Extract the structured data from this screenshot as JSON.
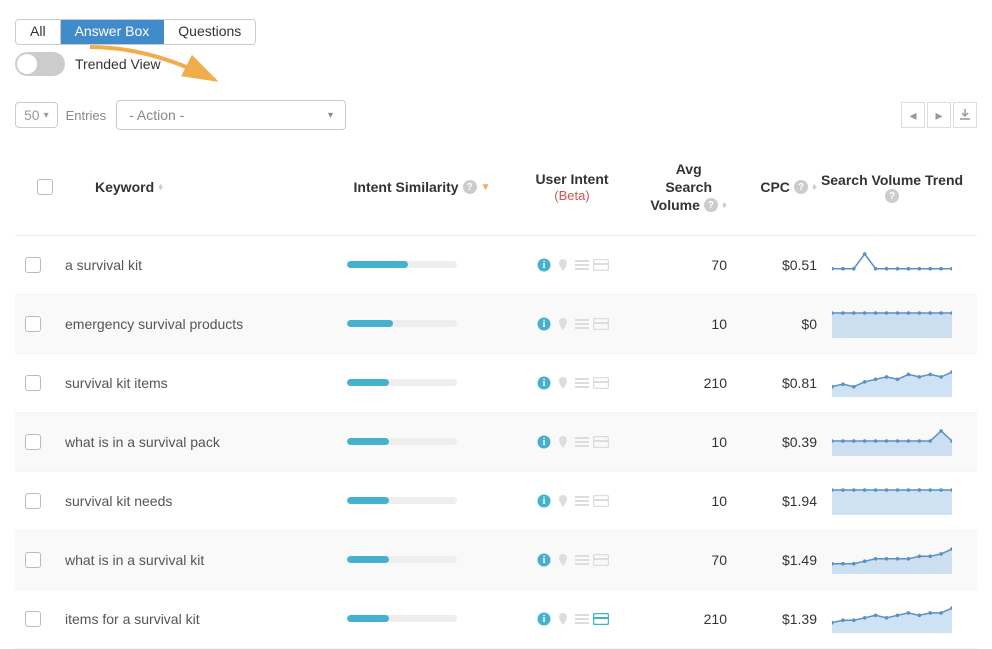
{
  "tabs": {
    "all": "All",
    "answerbox": "Answer Box",
    "questions": "Questions",
    "active": "answerbox"
  },
  "toggle": {
    "label": "Trended View"
  },
  "controls": {
    "entries_value": "50",
    "entries_label": "Entries",
    "action_placeholder": "- Action -"
  },
  "headers": {
    "keyword": "Keyword",
    "intent_similarity": "Intent Similarity",
    "user_intent": "User Intent",
    "user_intent_beta": "(Beta)",
    "avg_search_volume": "Avg Search Volume",
    "avg_l1": "Avg",
    "avg_l2": "Search",
    "avg_l3": "Volume",
    "cpc": "CPC",
    "search_volume_trend": "Search Volume Trend"
  },
  "rows": [
    {
      "keyword": "a survival kit",
      "intent": 55,
      "avg": "70",
      "cpc": "$0.51",
      "spark": [
        4,
        4,
        4,
        12,
        4,
        4,
        4,
        4,
        4,
        4,
        4,
        4
      ],
      "area": false,
      "card": false
    },
    {
      "keyword": "emergency survival products",
      "intent": 42,
      "avg": "10",
      "cpc": "$0",
      "spark": [
        8,
        8,
        8,
        8,
        8,
        8,
        8,
        8,
        8,
        8,
        8,
        8
      ],
      "area": true,
      "card": false
    },
    {
      "keyword": "survival kit items",
      "intent": 38,
      "avg": "210",
      "cpc": "$0.81",
      "spark": [
        3,
        4,
        3,
        5,
        6,
        7,
        6,
        8,
        7,
        8,
        7,
        9
      ],
      "area": true,
      "card": false
    },
    {
      "keyword": "what is in a survival pack",
      "intent": 38,
      "avg": "10",
      "cpc": "$0.39",
      "spark": [
        6,
        6,
        6,
        6,
        6,
        6,
        6,
        6,
        6,
        6,
        11,
        6
      ],
      "area": true,
      "card": false
    },
    {
      "keyword": "survival kit needs",
      "intent": 38,
      "avg": "10",
      "cpc": "$1.94",
      "spark": [
        8,
        8,
        8,
        8,
        8,
        8,
        8,
        8,
        8,
        8,
        8,
        8
      ],
      "area": true,
      "card": false
    },
    {
      "keyword": "what is in a survival kit",
      "intent": 38,
      "avg": "70",
      "cpc": "$1.49",
      "spark": [
        3,
        3,
        3,
        4,
        5,
        5,
        5,
        5,
        6,
        6,
        7,
        9
      ],
      "area": true,
      "card": false
    },
    {
      "keyword": "items for a survival kit",
      "intent": 38,
      "avg": "210",
      "cpc": "$1.39",
      "spark": [
        3,
        4,
        4,
        5,
        6,
        5,
        6,
        7,
        6,
        7,
        7,
        9
      ],
      "area": true,
      "card": true
    }
  ],
  "chart_data": [
    {
      "type": "line",
      "title": "Search Volume Trend — a survival kit",
      "values": [
        4,
        4,
        4,
        12,
        4,
        4,
        4,
        4,
        4,
        4,
        4,
        4
      ]
    },
    {
      "type": "area",
      "title": "Search Volume Trend — emergency survival products",
      "values": [
        8,
        8,
        8,
        8,
        8,
        8,
        8,
        8,
        8,
        8,
        8,
        8
      ]
    },
    {
      "type": "area",
      "title": "Search Volume Trend — survival kit items",
      "values": [
        3,
        4,
        3,
        5,
        6,
        7,
        6,
        8,
        7,
        8,
        7,
        9
      ]
    },
    {
      "type": "area",
      "title": "Search Volume Trend — what is in a survival pack",
      "values": [
        6,
        6,
        6,
        6,
        6,
        6,
        6,
        6,
        6,
        6,
        11,
        6
      ]
    },
    {
      "type": "area",
      "title": "Search Volume Trend — survival kit needs",
      "values": [
        8,
        8,
        8,
        8,
        8,
        8,
        8,
        8,
        8,
        8,
        8,
        8
      ]
    },
    {
      "type": "area",
      "title": "Search Volume Trend — what is in a survival kit",
      "values": [
        3,
        3,
        3,
        4,
        5,
        5,
        5,
        5,
        6,
        6,
        7,
        9
      ]
    },
    {
      "type": "area",
      "title": "Search Volume Trend — items for a survival kit",
      "values": [
        3,
        4,
        4,
        5,
        6,
        5,
        6,
        7,
        6,
        7,
        7,
        9
      ]
    }
  ]
}
